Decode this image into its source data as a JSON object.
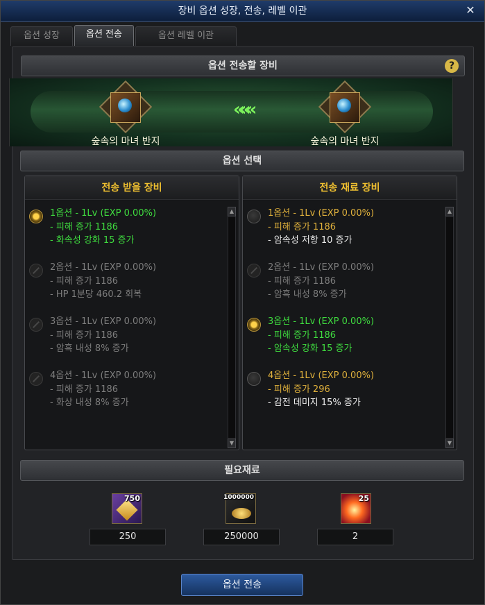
{
  "window": {
    "title": "장비 옵션 성장, 전송, 레벨 이관",
    "close_icon": "✕"
  },
  "tabs": [
    {
      "label": "옵션 성장",
      "active": false
    },
    {
      "label": "옵션 전송",
      "active": true
    },
    {
      "label": "옵션 레벨 이관",
      "active": false
    }
  ],
  "section_equipment": {
    "title": "옵션 전송할 장비",
    "help_icon": "?"
  },
  "transfer": {
    "target_item_name": "숲속의 마녀 반지",
    "source_item_name": "숲속의 마녀 반지",
    "arrow_icon": "«««"
  },
  "section_option_select": {
    "title": "옵션 선택"
  },
  "receive_panel": {
    "title": "전송 받을 장비",
    "options": [
      {
        "state": "selected",
        "header": "1옵션 - 1Lv (EXP 0.00%)",
        "line2": "- 피해 증가 1186",
        "line3": "- 화속성 강화 15 증가",
        "header_color": "green",
        "line2_color": "green",
        "line3_color": "green"
      },
      {
        "state": "disabled",
        "header": "2옵션 - 1Lv (EXP 0.00%)",
        "line2": "- 피해 증가 1186",
        "line3": "- HP 1분당 460.2 회복",
        "header_color": "gray",
        "line2_color": "gray",
        "line3_color": "gray"
      },
      {
        "state": "disabled",
        "header": "3옵션 - 1Lv (EXP 0.00%)",
        "line2": "- 피해 증가 1186",
        "line3": "- 암흑 내성 8% 증가",
        "header_color": "gray",
        "line2_color": "gray",
        "line3_color": "gray"
      },
      {
        "state": "disabled",
        "header": "4옵션 - 1Lv (EXP 0.00%)",
        "line2": "- 피해 증가 1186",
        "line3": "- 화상 내성 8% 증가",
        "header_color": "gray",
        "line2_color": "gray",
        "line3_color": "gray"
      }
    ]
  },
  "material_panel": {
    "title": "전송 재료 장비",
    "options": [
      {
        "state": "unselected",
        "header": "1옵션 - 1Lv (EXP 0.00%)",
        "line2": "- 피해 증가 1186",
        "line3": "- 암속성 저항 10 증가",
        "header_color": "gold",
        "line2_color": "gold",
        "line3_color": "white"
      },
      {
        "state": "disabled",
        "header": "2옵션 - 1Lv (EXP 0.00%)",
        "line2": "- 피해 증가 1186",
        "line3": "- 암흑 내성 8% 증가",
        "header_color": "gray",
        "line2_color": "gray",
        "line3_color": "gray"
      },
      {
        "state": "selected",
        "header": "3옵션 - 1Lv (EXP 0.00%)",
        "line2": "- 피해 증가 1186",
        "line3": "- 암속성 강화 15 증가",
        "header_color": "green",
        "line2_color": "green",
        "line3_color": "green"
      },
      {
        "state": "unselected",
        "header": "4옵션 - 1Lv (EXP 0.00%)",
        "line2": "- 피해 증가 296",
        "line3": "- 감전 데미지 15% 증가",
        "header_color": "gold",
        "line2_color": "gold",
        "line3_color": "white"
      }
    ]
  },
  "section_required": {
    "title": "필요재료"
  },
  "materials": [
    {
      "icon": "gold-crystal-icon",
      "count": "750",
      "quantity": "250"
    },
    {
      "icon": "gold-coins-icon",
      "count": "1000000",
      "quantity": "250000"
    },
    {
      "icon": "fire-orb-icon",
      "count": "25",
      "quantity": "2"
    }
  ],
  "action_button": {
    "label": "옵션 전송"
  }
}
